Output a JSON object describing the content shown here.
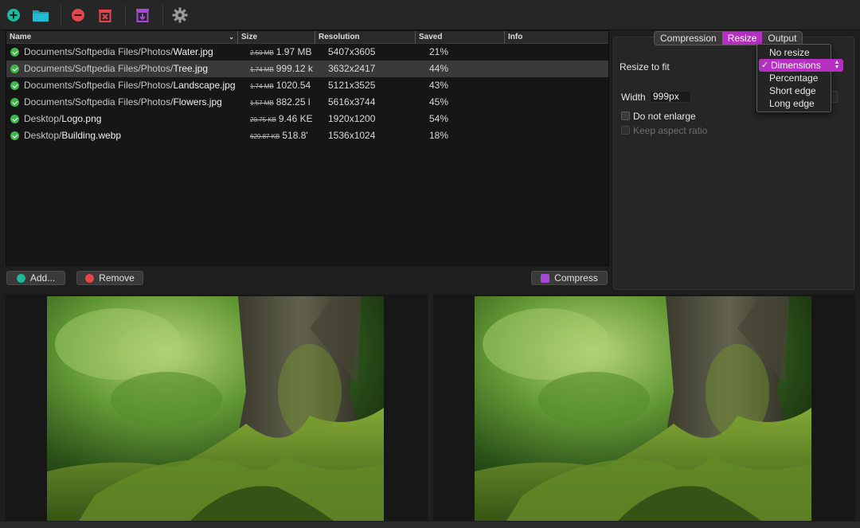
{
  "toolbar": {
    "buttons": [
      {
        "name": "add-icon",
        "color": "#1fb89a"
      },
      {
        "name": "open-folder-icon",
        "color": "#20b6c9"
      },
      {
        "name": "remove-icon",
        "color": "#e5464b"
      },
      {
        "name": "clear-icon",
        "color": "#e5464b"
      },
      {
        "name": "compress-icon",
        "color": "#a24ad6"
      },
      {
        "name": "gear-icon",
        "color": "#9a9a9a"
      }
    ]
  },
  "table": {
    "columns": [
      "Name",
      "Size",
      "Resolution",
      "Saved",
      "Info"
    ],
    "rows": [
      {
        "dir": "Documents/Softpedia Files/Photos/",
        "file": "Water.jpg",
        "old_size": "2.50 MB",
        "new_size": "1.97 MB",
        "resolution": "5407x3605",
        "saved": "21%"
      },
      {
        "dir": "Documents/Softpedia Files/Photos/",
        "file": "Tree.jpg",
        "old_size": "1.74 MB",
        "new_size": "999.12 k",
        "resolution": "3632x2417",
        "saved": "44%"
      },
      {
        "dir": "Documents/Softpedia Files/Photos/",
        "file": "Landscape.jpg",
        "old_size": "1.74 MB",
        "new_size": "1020.54",
        "resolution": "5121x3525",
        "saved": "43%"
      },
      {
        "dir": "Documents/Softpedia Files/Photos/",
        "file": "Flowers.jpg",
        "old_size": "1.57 MB",
        "new_size": "882.25 l",
        "resolution": "5616x3744",
        "saved": "45%"
      },
      {
        "dir": "Desktop/",
        "file": "Logo.png",
        "old_size": "20.75 KB",
        "new_size": "9.46 KE",
        "resolution": "1920x1200",
        "saved": "54%"
      },
      {
        "dir": "Desktop/",
        "file": "Building.webp",
        "old_size": "629.87 KB",
        "new_size": "518.8'",
        "resolution": "1536x1024",
        "saved": "18%"
      }
    ],
    "selected_row": 1
  },
  "actions": {
    "add_label": "Add...",
    "remove_label": "Remove",
    "compress_label": "Compress"
  },
  "settings": {
    "tabs": [
      "Compression",
      "Resize",
      "Output"
    ],
    "active_tab": "Resize",
    "resize_to_fit_label": "Resize to fit",
    "width_label": "Width",
    "width_value": "999px",
    "do_not_enlarge_label": "Do not enlarge",
    "keep_aspect_ratio_label": "Keep aspect ratio"
  },
  "resize_menu": {
    "options": [
      "No resize",
      "Dimensions",
      "Percentage",
      "Short edge",
      "Long edge"
    ],
    "selected": "Dimensions",
    "check_mark": "✓"
  },
  "colors": {
    "accent": "#b52fc0",
    "success": "#3fb64a"
  }
}
